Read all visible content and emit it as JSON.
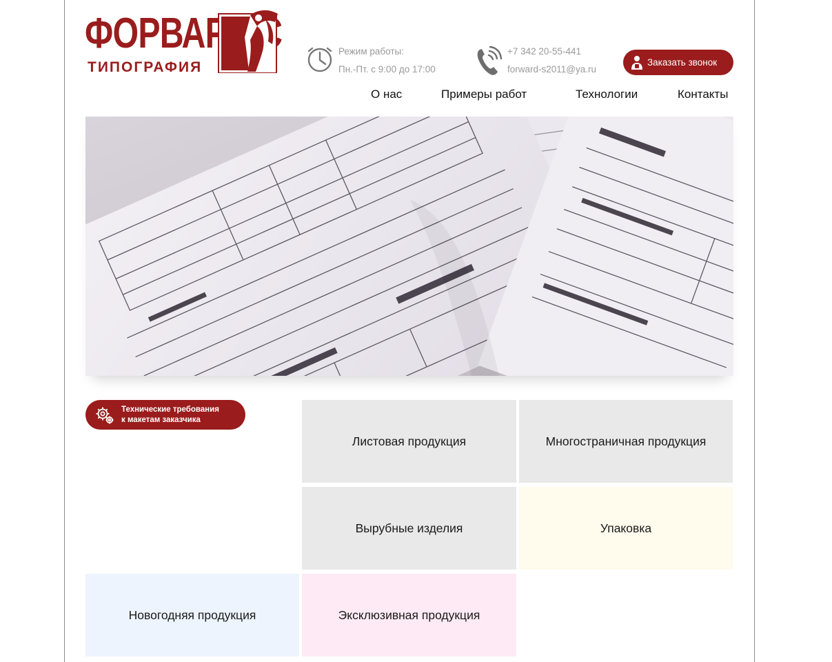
{
  "header": {
    "logo": {
      "title": "ФОРВАРД·С",
      "subtitle": "ТИПОГРАФИЯ",
      "emblem_icon": "winged-figure-icon"
    },
    "hours": {
      "label": "Режим работы:",
      "value": "Пн.-Пт. с 9:00 до 17:00",
      "icon": "clock-icon"
    },
    "contacts": {
      "phone": "+7 342 20-55-441",
      "email": "forward-s2011@ya.ru",
      "icon": "phone-icon"
    },
    "callback_button": {
      "label": "Заказать звонок",
      "icon": "person-phone-icon"
    }
  },
  "nav": {
    "items": [
      {
        "label": "О нас"
      },
      {
        "label": "Примеры работ"
      },
      {
        "label": "Технологии"
      },
      {
        "label": "Контакты"
      }
    ]
  },
  "hero": {
    "description_icon": "printed-receipt-forms-photo"
  },
  "tech_requirements": {
    "line1": "Технические требования",
    "line2": "к макетам заказчика",
    "icon": "gears-icon"
  },
  "products": [
    {
      "label": "Листовая продукция",
      "color": "#e9e9e9"
    },
    {
      "label": "Многостраничная продукция",
      "color": "#e9e9e9"
    },
    {
      "label": "Вырубные изделия",
      "color": "#e9e9e9"
    },
    {
      "label": "Упаковка",
      "color": "#fffbed"
    },
    {
      "label": "Новогодняя продукция",
      "color": "#edf4fd"
    },
    {
      "label": "Эксклюзивная продукция",
      "color": "#fdeaf4"
    }
  ],
  "colors": {
    "brand": "#9a1c1c",
    "muted_text": "#9a9a9a"
  }
}
